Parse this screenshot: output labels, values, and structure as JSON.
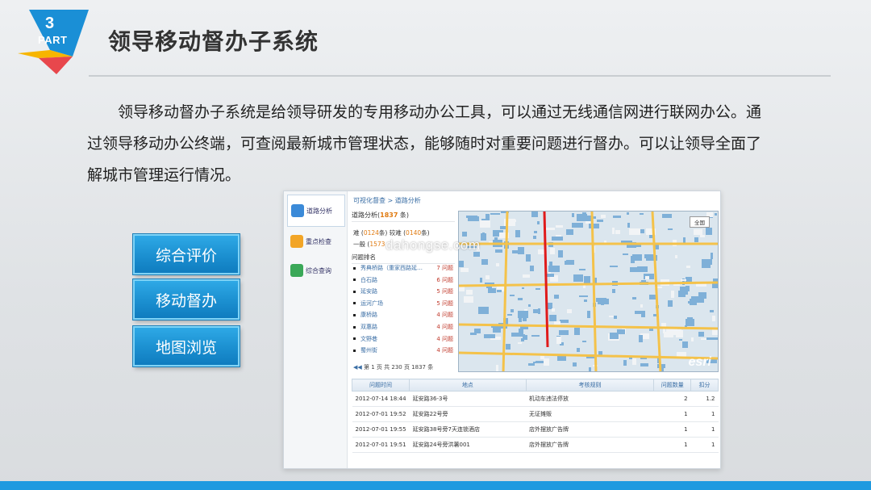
{
  "badge": {
    "number": "3",
    "label": "PART"
  },
  "title": "领导移动督办子系统",
  "intro": "领导移动督办子系统是给领导研发的专用移动办公工具，可以通过无线通信网进行联网办公。通过领导移动办公终端，可查阅最新城市管理状态，能够随时对重要问题进行督办。可以让领导全面了解城市管理运行情况。",
  "side_buttons": [
    "综合评价",
    "移动督办",
    "地图浏览"
  ],
  "screenshot": {
    "nav": [
      "道路分析",
      "重点检查",
      "综合查询"
    ],
    "breadcrumb": "可视化督查 > 道路分析",
    "summary_label": "道路分析(",
    "summary_count": "1837",
    "summary_unit": " 条)",
    "levels": [
      {
        "label": "难",
        "count": "0124",
        "unit": "条)",
        "label2": "较难",
        "count2": "0140",
        "unit2": "条)"
      },
      {
        "label": "一般",
        "count": "1573",
        "unit": ""
      }
    ],
    "ranking_title": "问题排名",
    "ranking": [
      {
        "name": "秀典桥路（重家西路延…",
        "count": "7 问题"
      },
      {
        "name": "白石路",
        "count": "6 问题"
      },
      {
        "name": "延安路",
        "count": "5 问题"
      },
      {
        "name": "运河广场",
        "count": "5 问题"
      },
      {
        "name": "康桥路",
        "count": "4 问题"
      },
      {
        "name": "双惠路",
        "count": "4 问题"
      },
      {
        "name": "文野巷",
        "count": "4 问题"
      },
      {
        "name": "蜀州街",
        "count": "4 问题"
      }
    ],
    "pager": "第 1 页  共 230 页 1837 条",
    "map_button": "全国",
    "map_logo": "esri",
    "table": {
      "headers": [
        "问题时间",
        "地点",
        "考核规则",
        "问题数量",
        "扣分"
      ],
      "rows": [
        [
          "2012-07-14 18:44",
          "延安路36-3号",
          "机动车违法停放",
          "2",
          "1.2"
        ],
        [
          "2012-07-01 19:52",
          "延安路22号旁",
          "无证摊贩",
          "1",
          "1"
        ],
        [
          "2012-07-01 19:55",
          "延安路38号旁7天连锁酒店",
          "店外摆放广告牌",
          "1",
          "1"
        ],
        [
          "2012-07-01 19:51",
          "延安路24号旁洪薯001",
          "店外摆放广告牌",
          "1",
          "1"
        ]
      ]
    }
  },
  "watermark": "dahongse.com",
  "colors": {
    "accent": "#1f9ae0",
    "button": "#1b8fd0",
    "badge_blue": "#1a8fd6",
    "badge_yellow": "#f7b500",
    "badge_red": "#e8474c"
  }
}
